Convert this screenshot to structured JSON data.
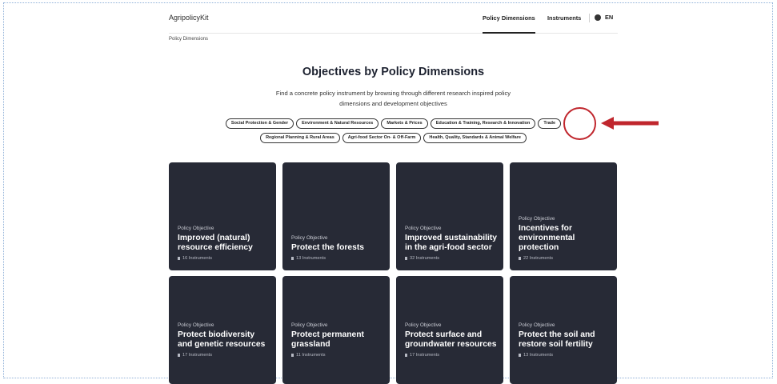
{
  "brand": "AgripolicyKit",
  "nav": {
    "links": [
      "Policy Dimensions",
      "Instruments"
    ],
    "lang": "EN"
  },
  "breadcrumb": "Policy Dimensions",
  "title": "Objectives by Policy Dimensions",
  "subtitle": "Find a concrete policy instrument by browsing through different research inspired policy dimensions and development objectives",
  "dimensions_row1": [
    "Social Protection & Gender",
    "Environment & Natural Resources",
    "Markets & Prices",
    "Education & Training, Research & Innovation",
    "Trade"
  ],
  "dimensions_row2": [
    "Regional Planning & Rural Areas",
    "Agri-food Sector On- & Off-Farm",
    "Health, Quality, Standards & Animal Welfare"
  ],
  "cards": [
    {
      "kicker": "Policy Objective",
      "title": "Improved (natural) resource efficiency",
      "meta": "16 Instruments"
    },
    {
      "kicker": "Policy Objective",
      "title": "Protect the forests",
      "meta": "13 Instruments"
    },
    {
      "kicker": "Policy Objective",
      "title": "Improved sustainability in the agri-food sector",
      "meta": "32 Instruments"
    },
    {
      "kicker": "Policy Objective",
      "title": "Incentives for environmental protection",
      "meta": "22 Instruments"
    },
    {
      "kicker": "Policy Objective",
      "title": "Protect biodiversity and genetic resources",
      "meta": "17 Instruments"
    },
    {
      "kicker": "Policy Objective",
      "title": "Protect permanent grassland",
      "meta": "11 Instruments"
    },
    {
      "kicker": "Policy Objective",
      "title": "Protect surface and groundwater resources",
      "meta": "17 Instruments"
    },
    {
      "kicker": "Policy Objective",
      "title": "Protect the soil and restore soil fertility",
      "meta": "13 Instruments"
    }
  ],
  "colors": {
    "card_bg": "#272a36",
    "annotation": "#c0262d"
  }
}
